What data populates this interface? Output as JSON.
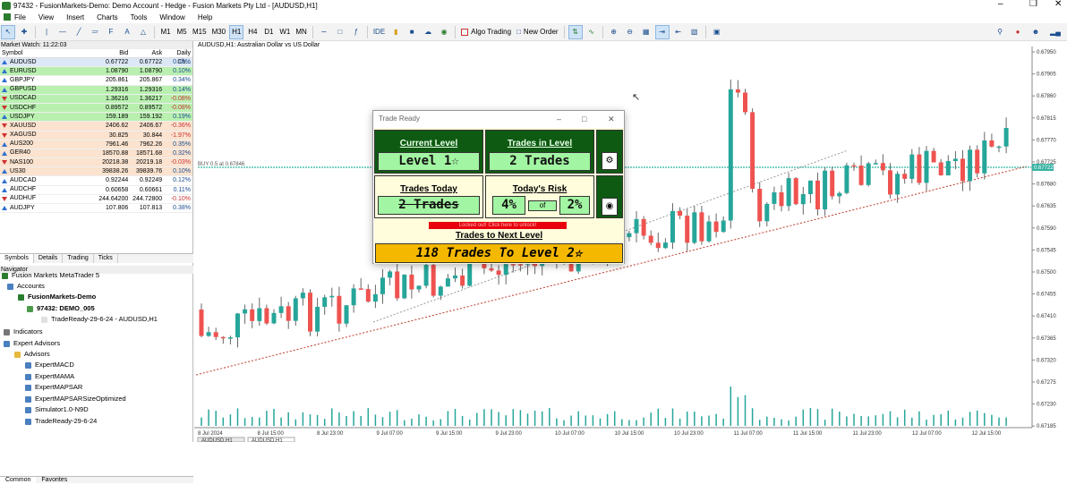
{
  "window": {
    "title": "97432 - FusionMarkets-Demo: Demo Account - Hedge - Fusion Markets Pty Ltd - [AUDUSD,H1]"
  },
  "menu": [
    "File",
    "View",
    "Insert",
    "Charts",
    "Tools",
    "Window",
    "Help"
  ],
  "toolbar": {
    "timeframes": [
      "M1",
      "M5",
      "M15",
      "M30",
      "H1",
      "H4",
      "D1",
      "W1",
      "MN"
    ],
    "active_tf": "H1",
    "ide": "IDE",
    "algo": "Algo Trading",
    "new_order": "New Order"
  },
  "market_watch": {
    "title": "Market Watch: 11:22:03",
    "headers": [
      "Symbol",
      "Bid",
      "Ask",
      "Daily Ch..."
    ],
    "rows": [
      {
        "sym": "AUDUSD",
        "bid": "0.67722",
        "ask": "0.67722",
        "chg": "0.19%",
        "bg": "#dde8f7",
        "dir": "up"
      },
      {
        "sym": "EURUSD",
        "bid": "1.08790",
        "ask": "1.08790",
        "chg": "0.10%",
        "bg": "#b9f0b0",
        "dir": "up"
      },
      {
        "sym": "GBPJPY",
        "bid": "205.861",
        "ask": "205.867",
        "chg": "0.34%",
        "bg": "#ffffff",
        "dir": "up"
      },
      {
        "sym": "GBPUSD",
        "bid": "1.29316",
        "ask": "1.29316",
        "chg": "0.14%",
        "bg": "#b9f0b0",
        "dir": "up"
      },
      {
        "sym": "USDCAD",
        "bid": "1.36216",
        "ask": "1.36217",
        "chg": "-0.08%",
        "bg": "#b9f0b0",
        "dir": "down"
      },
      {
        "sym": "USDCHF",
        "bid": "0.89572",
        "ask": "0.89572",
        "chg": "-0.08%",
        "bg": "#b9f0b0",
        "dir": "down"
      },
      {
        "sym": "USDJPY",
        "bid": "159.189",
        "ask": "159.192",
        "chg": "0.19%",
        "bg": "#b9f0b0",
        "dir": "up"
      },
      {
        "sym": "XAUUSD",
        "bid": "2406.62",
        "ask": "2406.67",
        "chg": "-0.36%",
        "bg": "#fbe3cf",
        "dir": "down"
      },
      {
        "sym": "XAGUSD",
        "bid": "30.825",
        "ask": "30.844",
        "chg": "-1.97%",
        "bg": "#fbe3cf",
        "dir": "down"
      },
      {
        "sym": "AUS200",
        "bid": "7961.46",
        "ask": "7962.26",
        "chg": "0.35%",
        "bg": "#fbe3cf",
        "dir": "up"
      },
      {
        "sym": "GER40",
        "bid": "18570.88",
        "ask": "18571.68",
        "chg": "0.32%",
        "bg": "#fbe3cf",
        "dir": "up"
      },
      {
        "sym": "NAS100",
        "bid": "20218.38",
        "ask": "20219.18",
        "chg": "-0.03%",
        "bg": "#fbe3cf",
        "dir": "down"
      },
      {
        "sym": "US30",
        "bid": "39838.26",
        "ask": "39839.76",
        "chg": "0.10%",
        "bg": "#fbe3cf",
        "dir": "up"
      },
      {
        "sym": "AUDCAD",
        "bid": "0.92244",
        "ask": "0.92249",
        "chg": "0.12%",
        "bg": "#ffffff",
        "dir": "up"
      },
      {
        "sym": "AUDCHF",
        "bid": "0.60658",
        "ask": "0.60661",
        "chg": "0.11%",
        "bg": "#ffffff",
        "dir": "up"
      },
      {
        "sym": "AUDHUF",
        "bid": "244.64200",
        "ask": "244.72800",
        "chg": "-0.10%",
        "bg": "#ffffff",
        "dir": "down"
      },
      {
        "sym": "AUDJPY",
        "bid": "107.806",
        "ask": "107.813",
        "chg": "0.38%",
        "bg": "#ffffff",
        "dir": "up"
      }
    ],
    "tabs": [
      "Symbols",
      "Details",
      "Trading",
      "Ticks"
    ]
  },
  "navigator": {
    "title": "Navigator",
    "items": [
      {
        "label": "Fusion Markets MetaTrader 5",
        "bold": false,
        "icon": "#2a7d2e"
      },
      {
        "label": "Accounts",
        "bold": false,
        "icon": "#4a7fc0"
      },
      {
        "label": "FusionMarkets-Demo",
        "bold": true,
        "icon": "#2a7d2e"
      },
      {
        "label": "97432: DEMO_005",
        "bold": true,
        "icon": "#4a9a4a"
      },
      {
        "label": "TradeReady-29-6-24 - AUDUSD,H1",
        "bold": false,
        "icon": "#e0e0e0"
      },
      {
        "label": "Indicators",
        "bold": false,
        "icon": "#777777"
      },
      {
        "label": "Expert Advisors",
        "bold": false,
        "icon": "#4a7fc0"
      },
      {
        "label": "Advisors",
        "bold": false,
        "icon": "#e6b93d"
      },
      {
        "label": "ExpertMACD",
        "bold": false,
        "icon": "#4a7fc0"
      },
      {
        "label": "ExpertMAMA",
        "bold": false,
        "icon": "#4a7fc0"
      },
      {
        "label": "ExpertMAPSAR",
        "bold": false,
        "icon": "#4a7fc0"
      },
      {
        "label": "ExpertMAPSARSizeOptimized",
        "bold": false,
        "icon": "#4a7fc0"
      },
      {
        "label": "Simulator1.0-N9D",
        "bold": false,
        "icon": "#4a7fc0"
      },
      {
        "label": "TradeReady-29-6-24",
        "bold": false,
        "icon": "#4a7fc0"
      }
    ],
    "tabs": [
      "Common",
      "Favorites"
    ]
  },
  "chart": {
    "label": "AUDUSD,H1:  Australian Dollar vs US Dollar",
    "price_labels": [
      "0.67950",
      "0.67905",
      "0.67860",
      "0.67815",
      "0.67770",
      "0.67725",
      "0.67680",
      "0.67635",
      "0.67590",
      "0.67545",
      "0.67500",
      "0.67455",
      "0.67410",
      "0.67365",
      "0.67320",
      "0.67275",
      "0.67230",
      "0.67185"
    ],
    "current_price": "0.67722",
    "time_labels": [
      "8 Jul 2024",
      "8 Jul 15:00",
      "8 Jul 23:00",
      "9 Jul 07:00",
      "9 Jul 15:00",
      "9 Jul 23:00",
      "10 Jul 07:00",
      "10 Jul 15:00",
      "10 Jul 23:00",
      "11 Jul 07:00",
      "11 Jul 15:00",
      "11 Jul 23:00",
      "12 Jul 07:00",
      "12 Jul 15:00"
    ],
    "left_line_label": "BUY 0.5 at 0.67846",
    "bottom_tabs": [
      "AUDUSD,H1",
      "AUDUSD,H1"
    ]
  },
  "trade_ready": {
    "title": "Trade Ready",
    "current_level_hdr": "Current Level",
    "current_level_val": "Level 1☆",
    "trades_in_level_hdr": "Trades in Level",
    "trades_in_level_val": "2 Trades",
    "trades_today_hdr": "Trades Today",
    "trades_today_val": "2 Trades",
    "risk_hdr": "Today's Risk",
    "risk_val": "4%",
    "risk_of": "of",
    "risk_max": "2%",
    "warning": "Locked out! Click here to unlock!",
    "next_hdr": "Trades to Next Level",
    "next_val": "118 Trades To Level 2☆"
  }
}
